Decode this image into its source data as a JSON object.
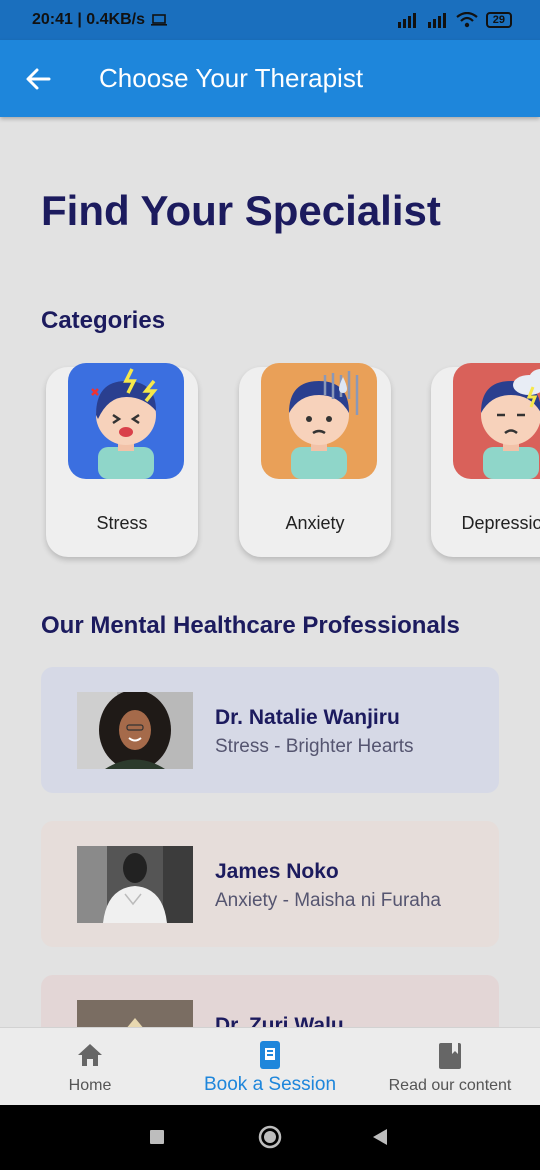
{
  "status_bar": {
    "time_speed": "20:41 | 0.4KB/s",
    "battery": "29"
  },
  "app_bar": {
    "title": "Choose Your Therapist"
  },
  "page": {
    "heading": "Find Your Specialist",
    "categories_heading": "Categories",
    "professionals_heading": "Our Mental Healthcare Professionals"
  },
  "categories": [
    {
      "label": "Stress",
      "bg": "#3b6fe0"
    },
    {
      "label": "Anxiety",
      "bg": "#e9a058"
    },
    {
      "label": "Depression",
      "bg": "#d9615a"
    }
  ],
  "therapists": [
    {
      "name": "Dr. Natalie Wanjiru",
      "detail": "Stress - Brighter Hearts",
      "card_bg": "#d6d9e6"
    },
    {
      "name": "James Noko",
      "detail": "Anxiety - Maisha ni Furaha",
      "card_bg": "#e6ddda"
    },
    {
      "name": "Dr. Zuri Walu",
      "detail": "",
      "card_bg": "#e3d6d6"
    }
  ],
  "bottom_nav": {
    "items": [
      {
        "label": "Home",
        "icon": "home-icon"
      },
      {
        "label": "Book a Session",
        "icon": "book-session-icon"
      },
      {
        "label": "Read our content",
        "icon": "book-icon"
      }
    ],
    "active_index": 1
  },
  "colors": {
    "primary": "#1e86db",
    "heading": "#1c1b5e",
    "status_bar": "#1a6fbe"
  }
}
